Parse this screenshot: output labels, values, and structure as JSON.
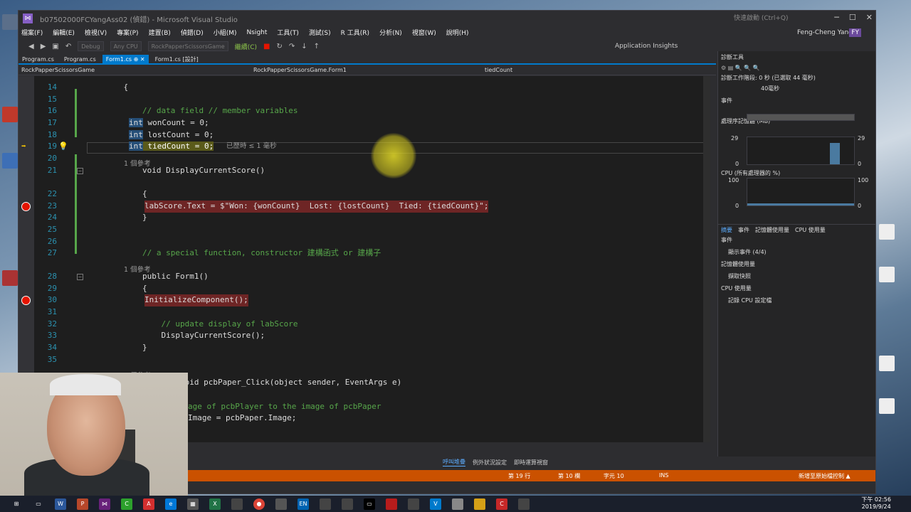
{
  "window": {
    "title": "b07502000FCYangAss02 (偵錯) - Microsoft Visual Studio",
    "quick_launch": "快速啟動 (Ctrl+Q)",
    "user": "Feng-Cheng Yang",
    "user_initials": "FY"
  },
  "menu": [
    "檔案(F)",
    "編輯(E)",
    "檢視(V)",
    "專案(P)",
    "建置(B)",
    "偵錯(D)",
    "小組(M)",
    "Nsight",
    "工具(T)",
    "測試(S)",
    "R 工具(R)",
    "分析(N)",
    "視窗(W)",
    "說明(H)"
  ],
  "toolbar": {
    "config": "Debug",
    "platform": "Any CPU",
    "startup": "RockPapperScissorsGame",
    "continue": "繼續(C)",
    "insights": "Application Insights"
  },
  "tabs": [
    {
      "label": "Program.cs",
      "active": false
    },
    {
      "label": "Program.cs",
      "active": false
    },
    {
      "label": "Form1.cs  ⊕ ✕",
      "active": true
    },
    {
      "label": "Form1.cs [設計]",
      "active": false
    }
  ],
  "navbar": {
    "project": "RockPapperScissorsGame",
    "class": "RockPapperScissorsGame.Form1",
    "member": "tiedCount"
  },
  "code": {
    "lines": [
      {
        "n": "14",
        "text": "    {"
      },
      {
        "n": "15",
        "text": ""
      },
      {
        "n": "16",
        "text": "        // data field // member variables"
      },
      {
        "n": "17",
        "kw": "int",
        "text": " wonCount = 0;"
      },
      {
        "n": "18",
        "kw": "int",
        "text": " lostCount = 0;"
      },
      {
        "n": "19",
        "kw": "int",
        "text": " tiedCount = 0;",
        "hint": "已歷時 ≤ 1 毫秒"
      },
      {
        "n": "20",
        "text": ""
      },
      {
        "n": "21",
        "text": "        void DisplayCurrentScore()"
      },
      {
        "n": "22",
        "text": "        {"
      },
      {
        "n": "23",
        "text": "labScore.Text = $\"Won: {wonCount}  Lost: {lostCount}  Tied: {tiedCount}\";"
      },
      {
        "n": "24",
        "text": "        }"
      },
      {
        "n": "25",
        "text": ""
      },
      {
        "n": "26",
        "text": ""
      },
      {
        "n": "27",
        "text": "        // a special function, constructor 建構函式 or 建構子"
      },
      {
        "n": "28",
        "text": "        public Form1()"
      },
      {
        "n": "29",
        "text": "        {"
      },
      {
        "n": "30",
        "text": "InitializeComponent();"
      },
      {
        "n": "31",
        "text": ""
      },
      {
        "n": "32",
        "text": "            // update display of labScore"
      },
      {
        "n": "33",
        "text": "            DisplayCurrentScore();"
      },
      {
        "n": "34",
        "text": "        }"
      },
      {
        "n": "35",
        "text": ""
      },
      {
        "n": "36",
        "text": "        private void pcbPaper_Click(object sender, EventArgs e)"
      }
    ],
    "refs": "1 個參考",
    "tail1": "age of pcbPlayer to the image of pcbPaper",
    "tail2": "Image = pcbPaper.Image;"
  },
  "bottom_tabs": [
    "呼叫堆疊",
    "例外狀況設定",
    "即時運算視窗"
  ],
  "status": {
    "line": "第 19 行",
    "col": "第 10 欄",
    "char": "字元 10",
    "mode": "INS",
    "source": "新增至原始檔控制 ▲"
  },
  "diagnostics": {
    "title": "診斷工具",
    "session": "診斷工作階段: 0 秒 (已選取 44 毫秒)",
    "ms_label": "40毫秒",
    "events": "事件",
    "memory": "處理序記憶體 (MB)",
    "mem_max": "29",
    "mem_min": "0",
    "cpu": "CPU (所有處理器的 %)",
    "cpu_max": "100",
    "cpu_min": "0",
    "tabs": [
      "摘要",
      "事件",
      "記憶體使用量",
      "CPU 使用量"
    ],
    "summary": {
      "events_h": "事件",
      "events_v": "顯示事件 (4/4)",
      "mem_h": "記憶體使用量",
      "mem_v": "擷取快照",
      "cpu_h": "CPU 使用量",
      "cpu_v": "記錄 CPU 設定檔"
    }
  },
  "taskbar": {
    "time": "下午 02:56",
    "date": "2019/9/24"
  }
}
